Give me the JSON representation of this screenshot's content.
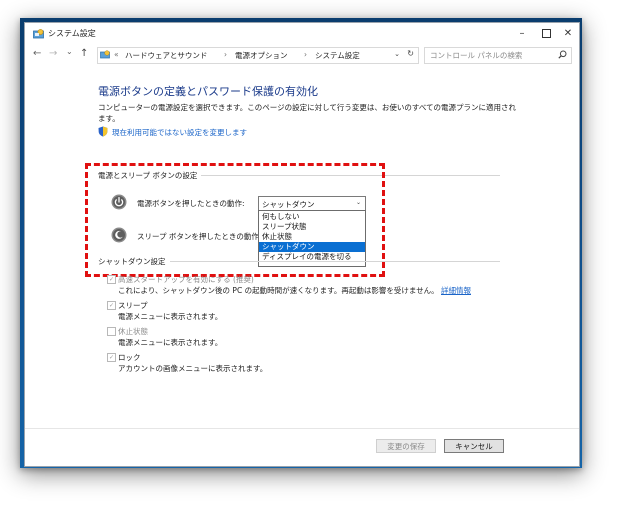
{
  "window": {
    "title": "システム設定",
    "min_glyph": "–",
    "close_glyph": "✕"
  },
  "address": {
    "back": "←",
    "forward": "→",
    "history": "⌄",
    "up": "↑",
    "crumbs": [
      "«",
      "ハードウェアとサウンド",
      "›",
      "電源オプション",
      "›",
      "システム設定"
    ],
    "dropdown": "⌄",
    "refresh": "↻",
    "search_placeholder": "コントロール パネルの検索"
  },
  "page": {
    "heading": "電源ボタンの定義とパスワード保護の有効化",
    "description": "コンピューターの電源設定を選択できます。このページの設定に対して行う変更は、お使いのすべての電源プランに適用されます。",
    "unavailable_link": "現在利用可能ではない設定を変更します"
  },
  "power_section": {
    "title": "電源とスリープ ボタンの設定",
    "power_button_label": "電源ボタンを押したときの動作:",
    "sleep_button_label": "スリープ ボタンを押したときの動作:",
    "combo_value": "シャットダウン",
    "combo_arrow": "⌄",
    "options": [
      "何もしない",
      "スリープ状態",
      "休止状態",
      "シャットダウン",
      "ディスプレイの電源を切る"
    ],
    "selected_index": 3
  },
  "shutdown_section": {
    "title": "シャットダウン設定",
    "fast_startup_label": "高速スタートアップを有効にする (推奨)",
    "fast_startup_desc": "これにより、シャットダウン後の PC の起動時間が速くなります。再起動は影響を受けません。",
    "more_info": "詳細情報",
    "sleep_label": "スリープ",
    "sleep_desc": "電源メニューに表示されます。",
    "hibernate_label": "休止状態",
    "hibernate_desc": "電源メニューに表示されます。",
    "lock_label": "ロック",
    "lock_desc": "アカウントの画像メニューに表示されます。",
    "check_mark": "✓"
  },
  "buttons": {
    "save": "変更の保存",
    "cancel": "キャンセル"
  },
  "colors": {
    "highlight_box": "#e01010",
    "selection": "#0a6fd2",
    "link": "#1a64c8",
    "heading": "#1a3a8a"
  }
}
